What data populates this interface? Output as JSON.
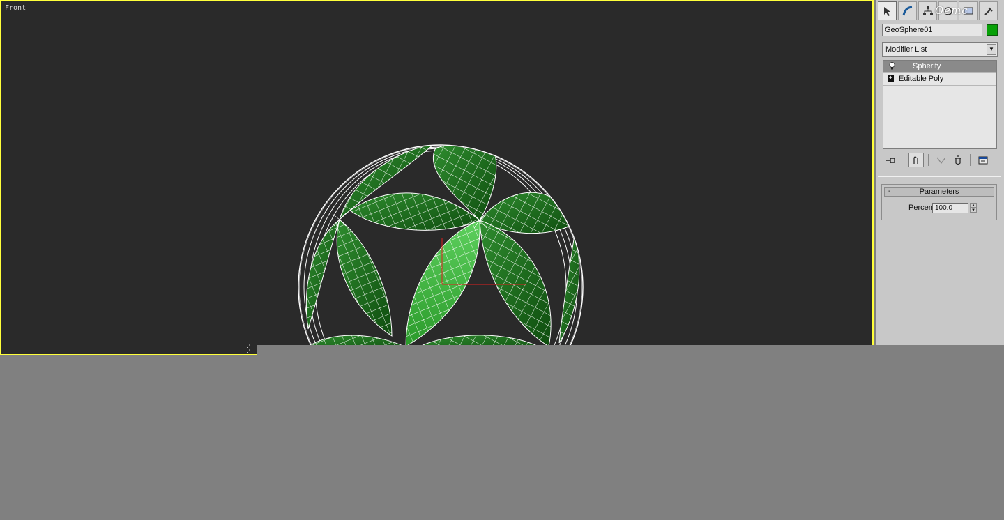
{
  "viewport": {
    "label": "Front",
    "border_color": "#ffff3a",
    "background": "#2a2a2a"
  },
  "object": {
    "name": "GeoSphere01",
    "color": "#06a006"
  },
  "command_panel": {
    "tabs": [
      {
        "icon": "create-cursor-icon",
        "active": true
      },
      {
        "icon": "modify-arc-icon",
        "active": false
      },
      {
        "icon": "hierarchy-icon",
        "active": false
      },
      {
        "icon": "motion-icon",
        "active": false
      },
      {
        "icon": "display-icon",
        "active": false
      },
      {
        "icon": "utilities-hammer-icon",
        "active": false
      }
    ],
    "watermark": "Oemc"
  },
  "modifier_list": {
    "selected": "Modifier List"
  },
  "stack": {
    "items": [
      {
        "label": "Spherify",
        "selected": true,
        "icon": "bulb-icon"
      },
      {
        "label": "Editable Poly",
        "selected": false,
        "icon": "plus-icon"
      }
    ]
  },
  "stack_tools": [
    {
      "icon": "pin-stack-icon"
    },
    {
      "icon": "show-end-result-icon"
    },
    {
      "icon": "make-unique-icon"
    },
    {
      "icon": "remove-modifier-icon"
    },
    {
      "icon": "configure-sets-icon"
    }
  ],
  "parameters": {
    "title": "Parameters",
    "collapse_symbol": "-",
    "percent_label": "Percent:",
    "percent_value": "100.0"
  }
}
